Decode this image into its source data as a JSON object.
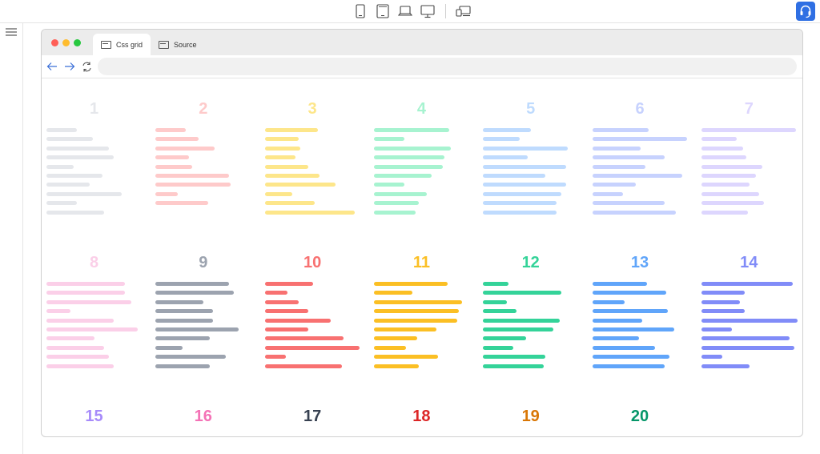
{
  "toolbar": {
    "layout_icon": "grid-layout-icon",
    "menu_icon": "hamburger-menu-icon",
    "devices": [
      "mobile-icon",
      "tablet-icon",
      "laptop-icon",
      "desktop-icon"
    ],
    "multi_device_icon": "multi-device-icon",
    "help_icon": "headset-help-icon"
  },
  "browser": {
    "tabs": [
      {
        "label": "Css grid",
        "active": true
      },
      {
        "label": "Source",
        "active": false
      }
    ],
    "url_value": "",
    "traffic_colors": [
      "#ff5f57",
      "#febc2e",
      "#28c840"
    ]
  },
  "grid": [
    {
      "label": "1",
      "color": "#e5e7eb",
      "bars": [
        38,
        58,
        78,
        84,
        34,
        70,
        54,
        94,
        38,
        72
      ]
    },
    {
      "label": "2",
      "color": "#fecaca",
      "bars": [
        38,
        54,
        74,
        42,
        46,
        92,
        94,
        28,
        66
      ]
    },
    {
      "label": "3",
      "color": "#fde68a",
      "bars": [
        66,
        42,
        44,
        38,
        54,
        68,
        88,
        34,
        62,
        112
      ]
    },
    {
      "label": "4",
      "color": "#a7f3d0",
      "bars": [
        94,
        38,
        96,
        88,
        86,
        72,
        38,
        66,
        56,
        52
      ]
    },
    {
      "label": "5",
      "color": "#bfdbfe",
      "bars": [
        60,
        46,
        106,
        56,
        104,
        78,
        104,
        98,
        92,
        92
      ]
    },
    {
      "label": "6",
      "color": "#c7d2fe",
      "bars": [
        70,
        118,
        60,
        90,
        66,
        112,
        54,
        38,
        90,
        104
      ]
    },
    {
      "label": "7",
      "color": "#ddd6fe",
      "bars": [
        118,
        44,
        52,
        56,
        76,
        68,
        60,
        72,
        78,
        58
      ]
    },
    {
      "label": "8",
      "color": "#fbcfe8",
      "bars": [
        98,
        98,
        106,
        30,
        84,
        114,
        60,
        72,
        78,
        84
      ]
    },
    {
      "label": "9",
      "color": "#9ca3af",
      "bars": [
        92,
        98,
        60,
        72,
        72,
        104,
        68,
        34,
        88,
        68
      ]
    },
    {
      "label": "10",
      "color": "#f87171",
      "bars": [
        60,
        28,
        42,
        54,
        82,
        54,
        98,
        118,
        26,
        96
      ]
    },
    {
      "label": "11",
      "color": "#fbbf24",
      "bars": [
        92,
        48,
        110,
        106,
        104,
        78,
        54,
        40,
        80,
        56
      ]
    },
    {
      "label": "12",
      "color": "#34d399",
      "bars": [
        32,
        98,
        30,
        42,
        96,
        88,
        54,
        38,
        78,
        76
      ]
    },
    {
      "label": "13",
      "color": "#60a5fa",
      "bars": [
        68,
        92,
        40,
        94,
        62,
        102,
        58,
        78,
        96,
        90
      ]
    },
    {
      "label": "14",
      "color": "#818cf8",
      "bars": [
        114,
        54,
        48,
        54,
        120,
        38,
        110,
        116,
        26,
        60
      ]
    },
    {
      "label": "15",
      "color": "#a78bfa",
      "bars": []
    },
    {
      "label": "16",
      "color": "#f472b6",
      "bars": []
    },
    {
      "label": "17",
      "color": "#374151",
      "bars": []
    },
    {
      "label": "18",
      "color": "#dc2626",
      "bars": []
    },
    {
      "label": "19",
      "color": "#d97706",
      "bars": []
    },
    {
      "label": "20",
      "color": "#059669",
      "bars": []
    }
  ]
}
